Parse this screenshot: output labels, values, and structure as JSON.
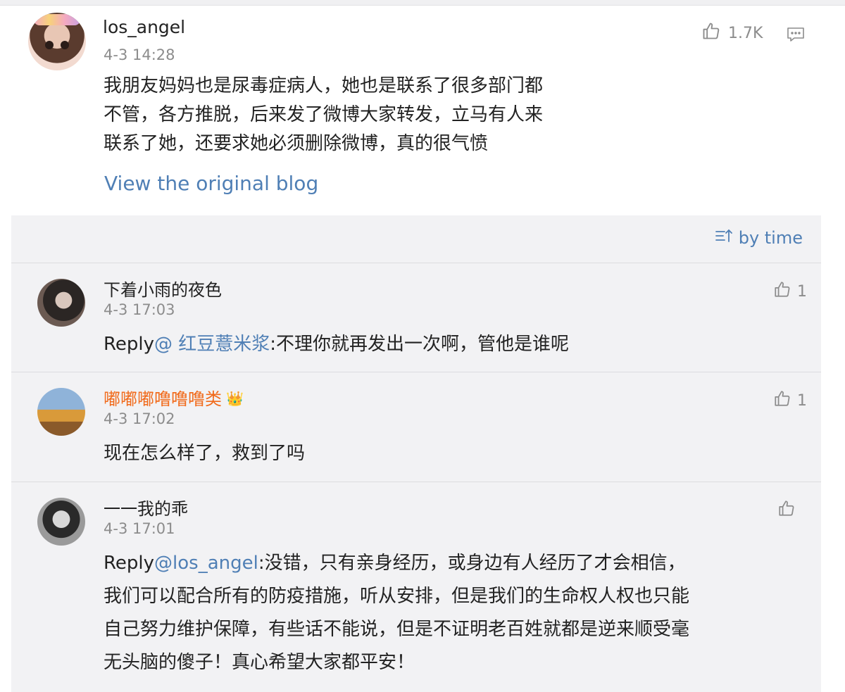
{
  "main_comment": {
    "username": "los_angel",
    "time": "4-3 14:28",
    "body_lines": [
      "我朋友妈妈也是尿毒症病人，她也是联系了很多部门都",
      "不管，各方推脱，后来发了微博大家转发，立马有人来",
      "联系了她，还要求她必须删除微博，真的很气愤"
    ],
    "like_count": "1.7K",
    "view_original_label": "View the original blog"
  },
  "replies_panel": {
    "sort_label": "by time",
    "replies": [
      {
        "username": "下着小雨的夜色",
        "time": "4-3 17:03",
        "prefix": "Reply",
        "mention": "@ 红豆薏米浆",
        "text": ":不理你就再发出一次啊，管他是谁呢",
        "likes": "1"
      },
      {
        "username": "嘟嘟嘟噜噜噜类",
        "time": "4-3 17:02",
        "text": "现在怎么样了，救到了吗",
        "likes": "1"
      },
      {
        "username": "一一我的乖",
        "time": "4-3 17:01",
        "prefix": "Reply",
        "mention": "@los_angel",
        "text_lines": [
          ":没错，只有亲身经历，或身边有人经历了才会相信，",
          "我们可以配合所有的防疫措施，听从安排，但是我们的生命权人权也只能",
          "自己努力维护保障，有些话不能说，但是不证明老百姓就都是逆来顺受毫",
          "无头脑的傻子！真心希望大家都平安！"
        ],
        "likes": ""
      }
    ]
  },
  "colors": {
    "link_blue": "#4f7fb5",
    "vip_orange": "#f16a1a",
    "meta_gray": "#8c8c8c",
    "panel_bg": "#f2f2f4"
  },
  "icons": [
    "thumbs-up-icon",
    "comment-icon",
    "sort-icon",
    "crown-icon"
  ]
}
